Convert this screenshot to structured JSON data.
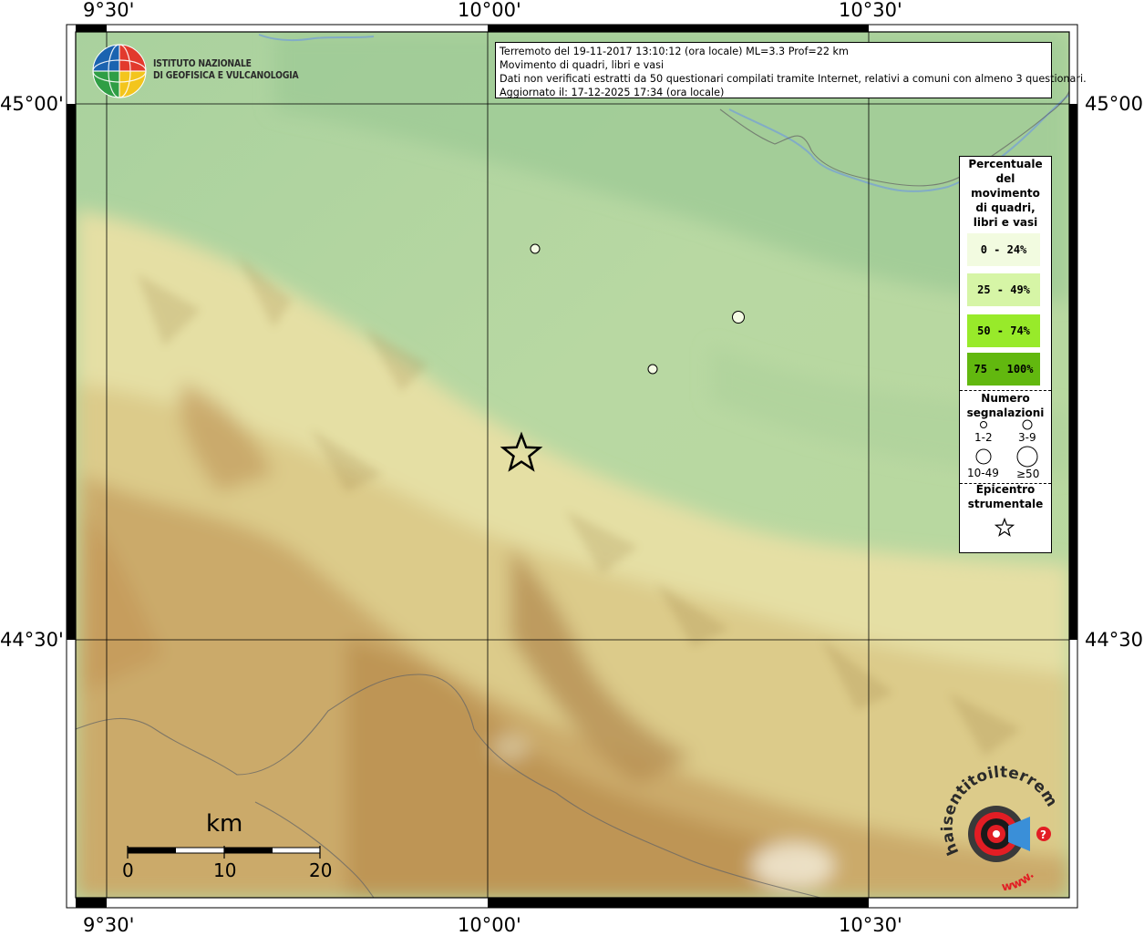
{
  "map": {
    "coordinates": {
      "lon_ticks": [
        "9°30'",
        "10°00'",
        "10°30'"
      ],
      "lat_ticks": [
        "45°00'",
        "44°30'"
      ]
    },
    "org": {
      "name_line1": "ISTITUTO NAZIONALE",
      "name_line2": "DI GEOFISICA E VULCANOLOGIA"
    },
    "info": {
      "line1": "Terremoto del 19-11-2017 13:10:12 (ora locale) ML=3.3 Prof=22 km",
      "line2": "Movimento di quadri, libri e vasi",
      "line3": "Dati non verificati estratti da 50 questionari compilati tramite Internet, relativi a comuni con almeno 3 questionari.",
      "line4": "Aggiornato il: 17-12-2025 17:34 (ora locale)"
    },
    "legend": {
      "percent_title_lines": [
        "Percentuale",
        "del",
        "movimento",
        "di quadri,",
        "libri e vasi"
      ],
      "percent_classes": [
        {
          "label": "0 - 24%",
          "color": "#f2fbe0"
        },
        {
          "label": "25 - 49%",
          "color": "#d6f5a6"
        },
        {
          "label": "50 - 74%",
          "color": "#98ea2a"
        },
        {
          "label": "75 - 100%",
          "color": "#62b80f"
        }
      ],
      "count_title_lines": [
        "Numero",
        "segnalazioni"
      ],
      "count_classes": [
        "1-2",
        "3-9",
        "10-49",
        "≥50"
      ],
      "epicenter_title_lines": [
        "Epicentro",
        "strumentale"
      ]
    },
    "scale": {
      "unit": "km",
      "labels": [
        "0",
        "10",
        "20"
      ]
    },
    "watermark": {
      "text": "haisentitoilterremoto.it",
      "www": "www.",
      "question": "?"
    },
    "colors": {
      "plain_green": "#9fcc98",
      "hill_yellow": "#e7dfa6",
      "mountain_brown": "#bf9a5a",
      "river_blue": "#7fb2d8",
      "frame_black": "#000000"
    },
    "observations": [
      {
        "lat": 44.82,
        "lon": 10.085,
        "percent_class": "0 - 24%",
        "count_class": "3-9"
      },
      {
        "lat": 44.71,
        "lon": 10.34,
        "percent_class": "0 - 24%",
        "count_class": "10-49"
      },
      {
        "lat": 44.66,
        "lon": 10.21,
        "percent_class": "0 - 24%",
        "count_class": "3-9"
      }
    ],
    "epicenter": {
      "lat": 44.57,
      "lon": 10.04
    }
  }
}
